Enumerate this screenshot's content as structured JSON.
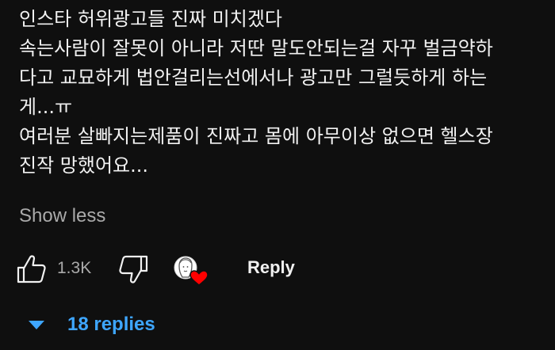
{
  "comment": {
    "lines": [
      "인스타 허위광고들 진짜 미치겠다",
      "속는사람이 잘못이 아니라 저딴 말도안되는걸 자꾸 벌금약하",
      "다고 교묘하게 법안걸리는선에서나 광고만 그럴듯하게 하는",
      "게...ㅠ",
      "여러분 살빠지는제품이 진짜고 몸에 아무이상 없으면 헬스장",
      "진작 망했어요..."
    ],
    "show_less_label": "Show less"
  },
  "actions": {
    "like_icon": "thumbs-up-icon",
    "like_count": "1.3K",
    "dislike_icon": "thumbs-down-icon",
    "creator_heart_icon": "creator-heart-icon",
    "reply_label": "Reply"
  },
  "replies": {
    "caret_icon": "caret-down-icon",
    "label": "18 replies",
    "accent_color": "#3ea6ff"
  },
  "colors": {
    "background": "#0f0f0f",
    "text_primary": "#f1f1f1",
    "text_secondary": "#aaaaaa",
    "heart": "#ff0000"
  }
}
